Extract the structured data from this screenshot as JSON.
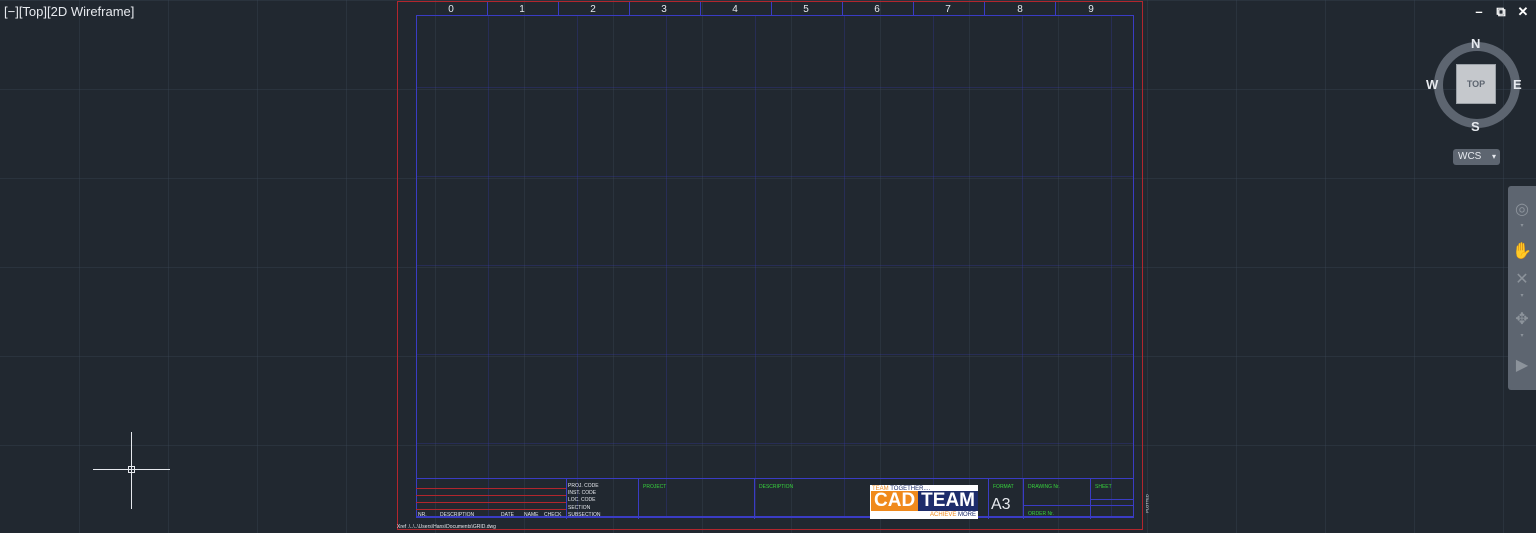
{
  "viewport": {
    "label": "[−][Top][2D Wireframe]"
  },
  "window_controls": {
    "minimize": "–",
    "restore": "⧉",
    "close": "✕"
  },
  "sheet": {
    "columns": [
      "0",
      "1",
      "2",
      "3",
      "4",
      "5",
      "6",
      "7",
      "8",
      "9"
    ],
    "codes": [
      "PROJ. CODE",
      "INST. CODE",
      "LOC. CODE",
      "SECTION",
      "SUBSECTION"
    ],
    "revision_headers": {
      "nr": "NR.",
      "description": "DESCRIPTION",
      "date": "DATE",
      "name": "NAME",
      "check": "CHECK"
    },
    "fields": {
      "project": "PROJECT",
      "description": "DESCRIPTION",
      "format": "FORMAT",
      "drawing_nr": "DRAWING Nr.",
      "sheet": "SHEET",
      "order_nr": "ORDER Nr.",
      "plotted": "PLOTTED"
    },
    "format_value": "A3",
    "logo": {
      "top_left": "TEAM",
      "top_right": "TOGETHER....",
      "cad": "CAD",
      "team": "TEAM",
      "bottom_left": "ACHIEVE",
      "bottom_right": "MORE"
    },
    "xref_path": "Xref .\\..\\..\\Users\\Hans\\Documents\\GRID.dwg"
  },
  "viewcube": {
    "north": "N",
    "south": "S",
    "east": "E",
    "west": "W",
    "face": "TOP",
    "wcs": "WCS",
    "wcs_caret": "▾"
  },
  "navbar": {
    "icons": [
      "steering-wheel-icon",
      "pan-icon",
      "zoom-extents-icon",
      "orbit-icon",
      "showmotion-icon"
    ]
  },
  "colors": {
    "background": "#212830",
    "sheet_border": "#b1262d",
    "frame": "#3a3cc4",
    "field_text": "#37d23c"
  }
}
